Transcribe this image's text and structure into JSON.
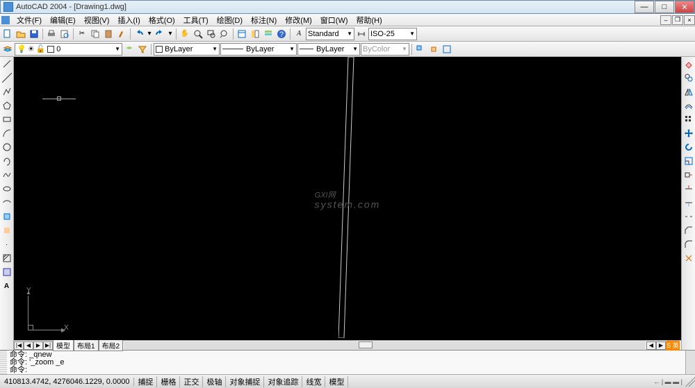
{
  "title": "AutoCAD 2004 - [Drawing1.dwg]",
  "menu": [
    "文件(F)",
    "编辑(E)",
    "视图(V)",
    "插入(I)",
    "格式(O)",
    "工具(T)",
    "绘图(D)",
    "标注(N)",
    "修改(M)",
    "窗口(W)",
    "帮助(H)"
  ],
  "toolbar_style": {
    "text_style": "Standard",
    "dim_style": "ISO-25"
  },
  "layer": {
    "current": "0",
    "color_mode": "ByLayer",
    "linetype": "ByLayer",
    "lineweight": "ByLayer",
    "plot_style": "ByColor"
  },
  "tabs": {
    "nav": [
      "|◀",
      "◀",
      "▶",
      "▶|"
    ],
    "items": [
      "模型",
      "布局1",
      "布局2"
    ],
    "active": 0
  },
  "command": {
    "line1": "命令: _qnew",
    "line2": "命令: '_zoom _e",
    "prompt": "命令:"
  },
  "status": {
    "coords": "410813.4742, 4276046.1229, 0.0000",
    "buttons": [
      "捕捉",
      "栅格",
      "正交",
      "极轴",
      "对象捕捉",
      "对象追踪",
      "线宽",
      "模型"
    ],
    "right": "← | ▬ ▬ |"
  },
  "ucs": {
    "x": "X",
    "y": "Y"
  },
  "ime": "S 英",
  "watermark": {
    "main": "GXI网",
    "sub": "system.com"
  },
  "left_tools": [
    "line",
    "xline",
    "pline",
    "polygon",
    "rect",
    "arc",
    "circle",
    "spline",
    "ellipse",
    "ellipse-arc",
    "block",
    "point",
    "hatch",
    "region",
    "table",
    "text"
  ],
  "right_tools": [
    "erase",
    "copy",
    "mirror",
    "offset",
    "array",
    "move",
    "rotate",
    "scale",
    "stretch",
    "trim",
    "extend",
    "break",
    "chamfer",
    "fillet",
    "explode"
  ],
  "std_tools": [
    "new",
    "open",
    "save",
    "print",
    "preview",
    "cut",
    "copy",
    "paste",
    "match",
    "undo",
    "redo",
    "pan",
    "zoom",
    "zoom-win",
    "zoom-prev",
    "props",
    "design-center",
    "tool-palette",
    "help"
  ]
}
